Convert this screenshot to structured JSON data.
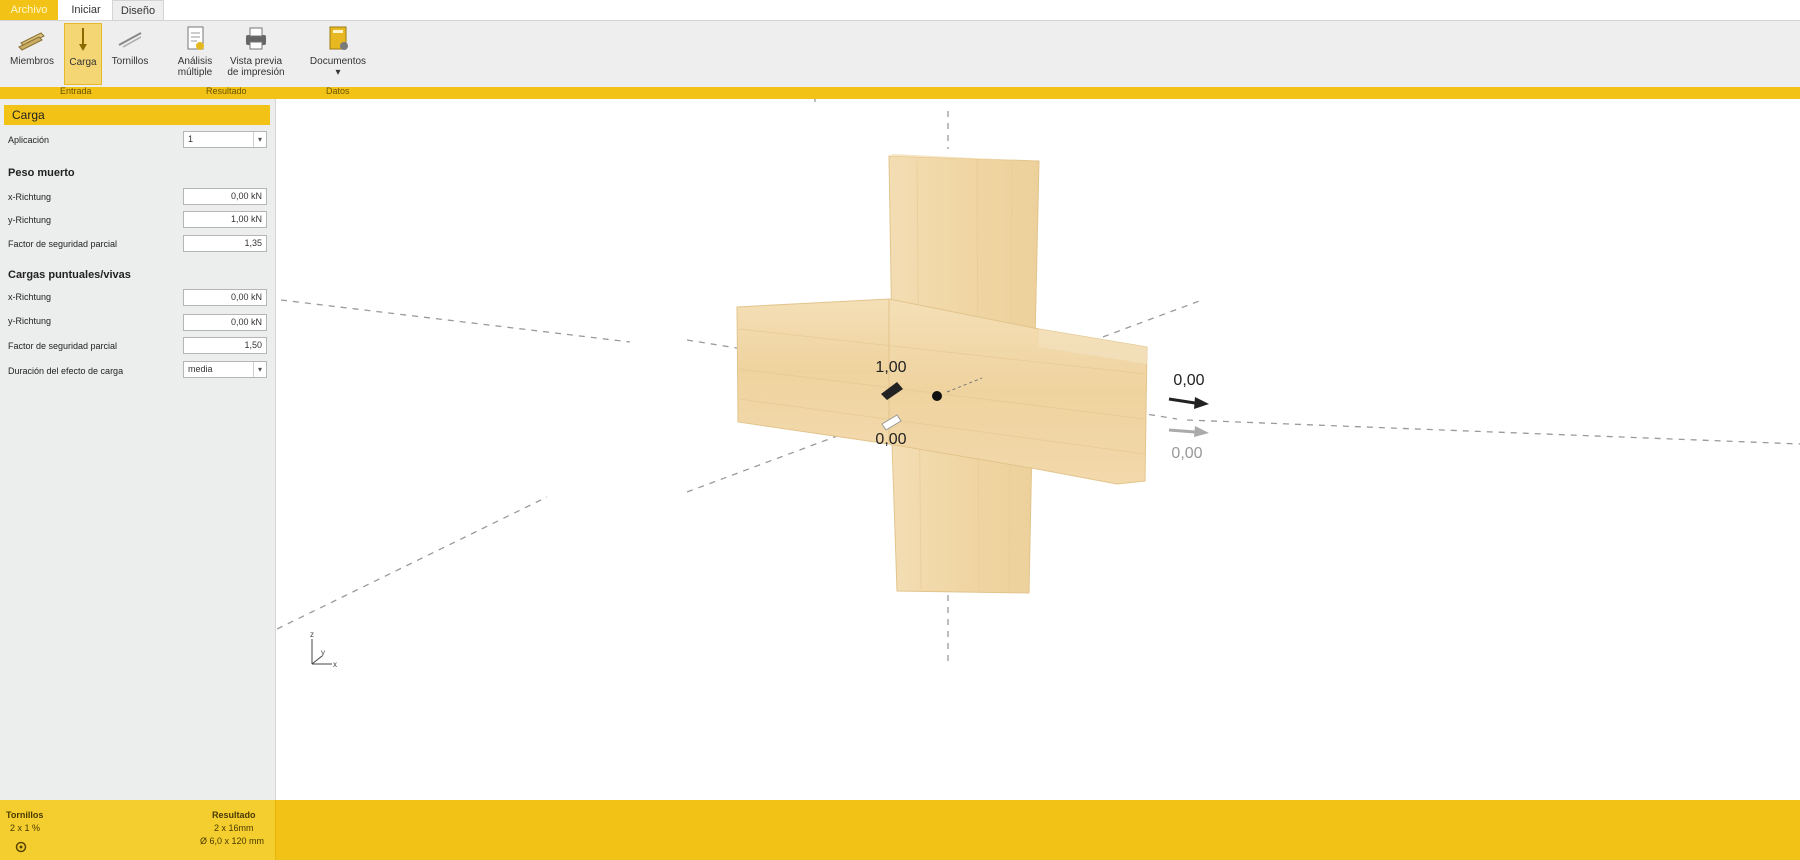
{
  "tabs": {
    "file": "Archivo",
    "inicio": "Iniciar",
    "diseno": "Diseño"
  },
  "ribbon": {
    "miembros": "Miembros",
    "carga": "Carga",
    "tornillos": "Tornillos",
    "analisis_1": "Análisis",
    "analisis_2": "múltiple",
    "vista_1": "Vista previa",
    "vista_2": "de impresión",
    "documentos": "Documentos",
    "documentos_caret": "▾",
    "groups": {
      "entrada": "Entrada",
      "resultado": "Resultado",
      "datos": "Datos"
    }
  },
  "panel": {
    "title": "Carga",
    "aplicacion_label": "Aplicación",
    "aplicacion_value": "1",
    "peso_muerto_title": "Peso muerto",
    "pm_x_label": "x-Richtung",
    "pm_x_value": "0,00 kN",
    "pm_y_label": "y-Richtung",
    "pm_y_value": "1,00 kN",
    "pm_factor_label": "Factor de seguridad parcial",
    "pm_factor_value": "1,35",
    "cargas_title": "Cargas puntuales/vivas",
    "cv_x_label": "x-Richtung",
    "cv_x_value": "0,00 kN",
    "cv_y_label": "y-Richtung",
    "cv_y_value": "0,00 kN",
    "cv_factor_label": "Factor de seguridad parcial",
    "cv_factor_value": "1,50",
    "duracion_label": "Duración del efecto de carga",
    "duracion_value": "media",
    "dropdown_arrow": "▾"
  },
  "viewport": {
    "load_label_top": "1,00",
    "load_label_bottom": "0,00",
    "load_label_right_top": "0,00",
    "load_label_right_bottom": "0,00",
    "axis_z": "z",
    "axis_y": "y",
    "axis_x": "x"
  },
  "status": {
    "left_title": "Tornillos",
    "left_value": "2 x 1 %",
    "right_title": "Resultado",
    "right_value_1": "2 x 16mm",
    "right_value_2": "Ø 6,0 x 120 mm"
  },
  "colors": {
    "accent": "#f2c316",
    "wood": "#f2dcb1",
    "panel": "#eceded"
  }
}
